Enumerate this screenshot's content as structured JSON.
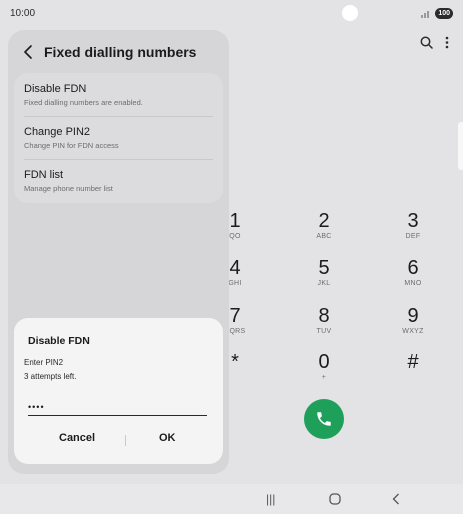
{
  "status_bar": {
    "time": "10:00",
    "battery": "100",
    "icons": [
      "camera-dot",
      "signal-icon",
      "battery-icon"
    ]
  },
  "dialer": {
    "actions": [
      "search-icon",
      "more-options-icon"
    ],
    "keys": [
      {
        "digit": "1",
        "letters": "QO"
      },
      {
        "digit": "2",
        "letters": "ABC"
      },
      {
        "digit": "3",
        "letters": "DEF"
      },
      {
        "digit": "4",
        "letters": "GHI"
      },
      {
        "digit": "5",
        "letters": "JKL"
      },
      {
        "digit": "6",
        "letters": "MNO"
      },
      {
        "digit": "7",
        "letters": "PQRS"
      },
      {
        "digit": "8",
        "letters": "TUV"
      },
      {
        "digit": "9",
        "letters": "WXYZ"
      },
      {
        "digit": "*",
        "letters": ""
      },
      {
        "digit": "0",
        "letters": "+"
      },
      {
        "digit": "#",
        "letters": ""
      }
    ],
    "call_icon": "phone-icon",
    "call_color": "#1fa05a"
  },
  "panel": {
    "title": "Fixed dialling numbers",
    "items": [
      {
        "label": "Disable FDN",
        "sub": "Fixed dialling numbers are enabled."
      },
      {
        "label": "Change PIN2",
        "sub": "Change PIN for FDN access"
      },
      {
        "label": "FDN list",
        "sub": "Manage phone number list"
      }
    ]
  },
  "dialog": {
    "title": "Disable FDN",
    "prompt": "Enter PIN2",
    "attempts": "3 attempts left.",
    "pin_value": "••••",
    "cancel_label": "Cancel",
    "ok_label": "OK"
  },
  "nav_bar": {
    "recents": "|||",
    "home_icon": "home-icon",
    "back_icon": "back-icon"
  }
}
